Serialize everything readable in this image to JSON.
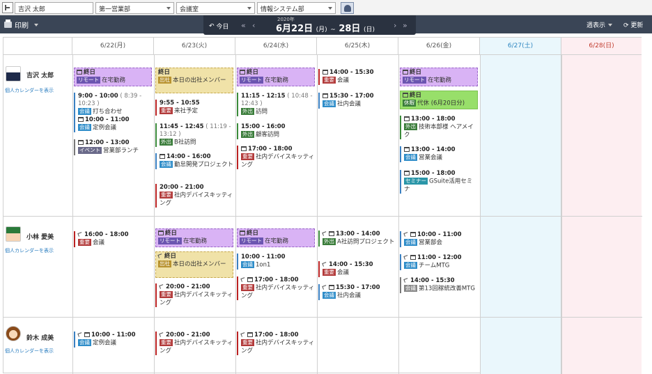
{
  "filters": {
    "user": "吉沢 太郎",
    "group1": "第一営業部",
    "group2": "会議室",
    "group3": "情報システム部"
  },
  "toolbar": {
    "print": "印刷",
    "today": "今日",
    "year": "2020年",
    "range_start": "6月22日",
    "range_start_dow": "(月)",
    "range_sep": "~",
    "range_end": "28日",
    "range_end_dow": "(日)",
    "week_view": "週表示",
    "refresh": "更新"
  },
  "days": [
    "6/22(月)",
    "6/23(火)",
    "6/24(水)",
    "6/25(木)",
    "6/26(金)",
    "6/27(土)",
    "6/28(日)"
  ],
  "people": [
    {
      "name": "吉沢 太郎",
      "link": "個人カレンダーを表示"
    },
    {
      "name": "小林 愛美",
      "link": "個人カレンダーを表示"
    },
    {
      "name": "鈴木 成美",
      "link": "個人カレンダーを表示"
    }
  ],
  "events": {
    "p0d0a": {
      "title": "終日",
      "tag": "リモート",
      "text": "在宅勤務"
    },
    "p0d0b": {
      "time": "9:00 - 10:00",
      "sub": "( 8:39 - 10:23 )",
      "tag": "会議",
      "text": "打ち合わせ"
    },
    "p0d0c": {
      "time": "10:00 - 11:00",
      "tag": "会議",
      "text": "定例会議"
    },
    "p0d0d": {
      "time": "12:00 - 13:00",
      "tag": "イベント",
      "text": "営業部ランチ"
    },
    "p0d1a": {
      "title": "終日",
      "tag": "出社",
      "text": "本日の出社メンバー"
    },
    "p0d1b": {
      "time": "9:55 - 10:55",
      "tag": "重要",
      "text": "来社予定"
    },
    "p0d1c": {
      "time": "11:45 - 12:45",
      "sub": "( 11:19 - 13:12 )",
      "tag": "外出",
      "text": "B社訪問"
    },
    "p0d1d": {
      "time": "14:00 - 16:00",
      "tag": "会議",
      "text": "勤怠開発プロジェクト"
    },
    "p0d1e": {
      "time": "20:00 - 21:00",
      "tag": "重要",
      "text": "社内デバイスキッティング"
    },
    "p0d2a": {
      "title": "終日",
      "tag": "リモート",
      "text": "在宅勤務"
    },
    "p0d2b": {
      "time": "11:15 - 12:15",
      "sub": "( 10:48 - 12:43 )",
      "tag": "外出",
      "text": "訪問"
    },
    "p0d2c": {
      "time": "15:00 - 16:00",
      "tag": "外出",
      "text": "顧客訪問"
    },
    "p0d2d": {
      "time": "17:00 - 18:00",
      "tag": "重要",
      "text": "社内デバイスキッティング"
    },
    "p0d3a": {
      "time": "14:00 - 15:30",
      "tag": "重要",
      "text": "会議"
    },
    "p0d3b": {
      "time": "15:30 - 17:00",
      "tag": "会議",
      "text": "社内会議"
    },
    "p0d4a": {
      "title": "終日",
      "tag": "リモート",
      "text": "在宅勤務"
    },
    "p0d4b": {
      "title": "終日",
      "tag": "休暇",
      "text": "代休 (6月20日分)"
    },
    "p0d4c": {
      "time": "13:00 - 18:00",
      "tag": "外出",
      "text": "技術本部様 ヘアメイク"
    },
    "p0d4d": {
      "time": "13:00 - 14:00",
      "tag": "会議",
      "text": "営業会議"
    },
    "p0d4e": {
      "time": "15:00 - 18:00",
      "tag": "セミナー",
      "text": "GSuite活用セミナ"
    },
    "p1d0a": {
      "time": "16:00 - 18:00",
      "tag": "重要",
      "text": "会議"
    },
    "p1d1a": {
      "title": "終日",
      "tag": "リモート",
      "text": "在宅勤務"
    },
    "p1d1b": {
      "title": "終日",
      "tag": "出社",
      "text": "本日の出社メンバー"
    },
    "p1d1c": {
      "time": "20:00 - 21:00",
      "tag": "重要",
      "text": "社内デバイスキッティング"
    },
    "p1d2a": {
      "title": "終日",
      "tag": "リモート",
      "text": "在宅勤務"
    },
    "p1d2b": {
      "time": "10:00 - 11:00",
      "tag": "会議",
      "text": "1on1"
    },
    "p1d2c": {
      "time": "17:00 - 18:00",
      "tag": "重要",
      "text": "社内デバイスキッティング"
    },
    "p1d3a": {
      "time": "13:00 - 14:00",
      "tag": "外出",
      "text": "A社訪問プロジェクト"
    },
    "p1d3b": {
      "time": "14:00 - 15:30",
      "tag": "重要",
      "text": "会議"
    },
    "p1d3c": {
      "time": "15:30 - 17:00",
      "tag": "会議",
      "text": "社内会議"
    },
    "p1d4a": {
      "time": "10:00 - 11:00",
      "tag": "会議",
      "text": "営業部会"
    },
    "p1d4b": {
      "time": "11:00 - 12:00",
      "tag": "会議",
      "text": "チームMTG"
    },
    "p1d4c": {
      "time": "14:00 - 15:30",
      "tag": "会議",
      "text": "第13回稼統改善MTG"
    },
    "p2d0a": {
      "time": "10:00 - 11:00",
      "tag": "会議",
      "text": "定例会議"
    },
    "p2d1a": {
      "time": "20:00 - 21:00",
      "tag": "重要",
      "text": "社内デバイスキッティング"
    },
    "p2d2a": {
      "time": "17:00 - 18:00",
      "tag": "重要",
      "text": "社内デバイスキッティング"
    }
  }
}
